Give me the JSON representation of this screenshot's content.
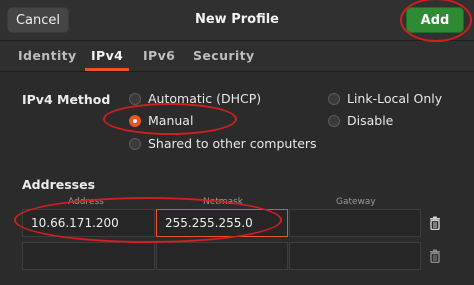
{
  "header": {
    "cancel_label": "Cancel",
    "title": "New Profile",
    "add_label": "Add"
  },
  "tabs": [
    {
      "label": "Identity",
      "active": false
    },
    {
      "label": "IPv4",
      "active": true
    },
    {
      "label": "IPv6",
      "active": false
    },
    {
      "label": "Security",
      "active": false
    }
  ],
  "ipv4": {
    "method_label": "IPv4 Method",
    "options": [
      {
        "label": "Automatic (DHCP)",
        "checked": false
      },
      {
        "label": "Manual",
        "checked": true
      },
      {
        "label": "Shared to other computers",
        "checked": false
      },
      {
        "label": "Link-Local Only",
        "checked": false
      },
      {
        "label": "Disable",
        "checked": false
      }
    ]
  },
  "addresses": {
    "label": "Addresses",
    "columns": {
      "address": "Address",
      "netmask": "Netmask",
      "gateway": "Gateway"
    },
    "rows": [
      {
        "address": "10.66.171.200",
        "netmask": "255.255.255.0",
        "gateway": ""
      },
      {
        "address": "",
        "netmask": "",
        "gateway": ""
      }
    ]
  },
  "colors": {
    "accent": "#e95420",
    "add_button": "#2f8a34",
    "annotation": "#d21e1e"
  },
  "icons": {
    "delete_row": "trash-icon"
  }
}
